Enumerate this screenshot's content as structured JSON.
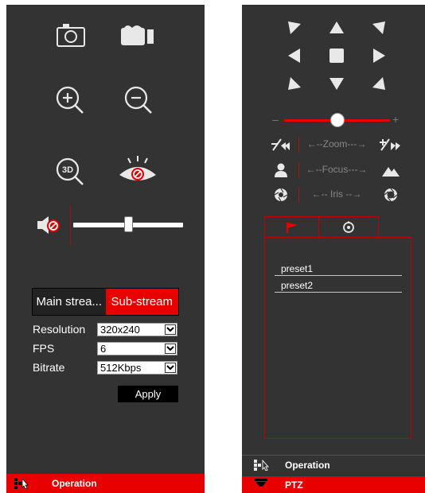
{
  "left_panel": {
    "stream_tabs": {
      "main_label": "Main strea...",
      "sub_label": "Sub-stream",
      "selected": "Sub-stream"
    },
    "resolution": {
      "label": "Resolution",
      "value": "320x240"
    },
    "fps": {
      "label": "FPS",
      "value": "6"
    },
    "bitrate": {
      "label": "Bitrate",
      "value": "512Kbps"
    },
    "apply_label": "Apply",
    "volume_level": 0.5,
    "bottom_bar_label": "Operation"
  },
  "right_panel": {
    "zoom_label": "←--Zoom---→",
    "focus_label": "←--Focus---→",
    "iris_label": "←-- Iris --→",
    "speed_level": 0.5,
    "presets": [
      "preset1",
      "preset2"
    ],
    "operation_label": "Operation",
    "ptz_label": "PTZ"
  },
  "colors": {
    "accent": "#e80000",
    "panel": "#333333",
    "text": "#ffffff"
  },
  "icons": [
    "snapshot-icon",
    "record-icon",
    "zoom-in-icon",
    "zoom-out-icon",
    "3d-zoom-icon",
    "privacy-eye-icon",
    "mute-icon",
    "ptz-arrow-icons",
    "zoom-tele-icon",
    "zoom-wide-icon",
    "focus-near-icon",
    "focus-far-icon",
    "iris-close-icon",
    "iris-open-icon",
    "preset-flag-icon",
    "cruise-icon",
    "operation-icon",
    "ptz-dome-icon"
  ]
}
